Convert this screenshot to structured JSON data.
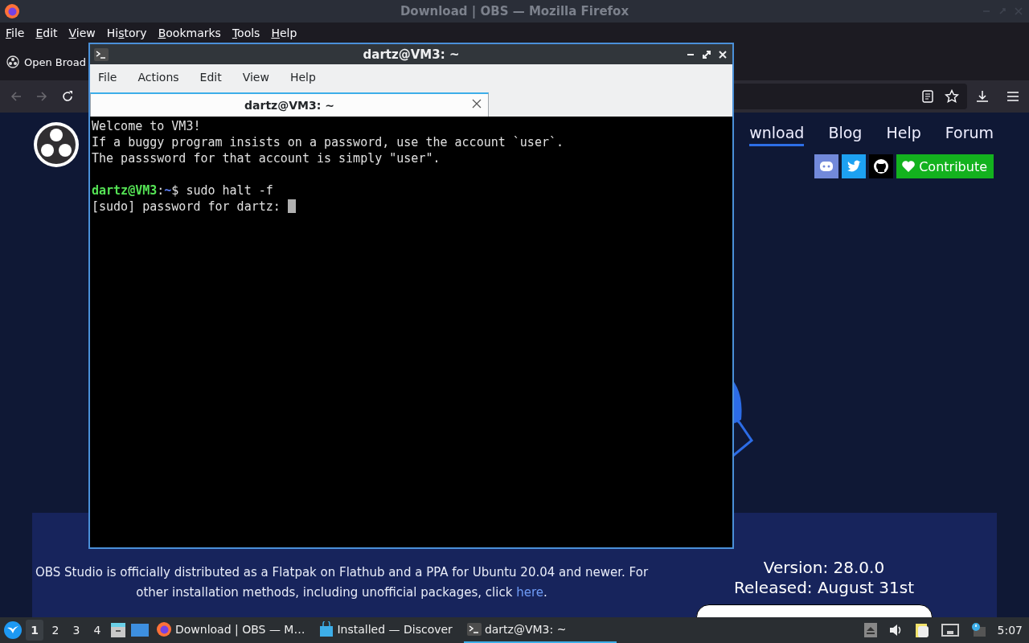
{
  "firefox": {
    "title": "Download | OBS — Mozilla Firefox",
    "menu": [
      {
        "key": "F",
        "after": "ile"
      },
      {
        "key": "E",
        "after": "dit"
      },
      {
        "key": "V",
        "after": "iew"
      },
      {
        "before": "Hi",
        "key": "s",
        "after": "tory"
      },
      {
        "key": "B",
        "after": "ookmarks"
      },
      {
        "key": "T",
        "after": "ools"
      },
      {
        "key": "H",
        "after": "elp"
      }
    ],
    "bookmark": "Open Broad",
    "page": {
      "nav": [
        {
          "label": "wnload",
          "selected": true
        },
        {
          "label": "Blog",
          "selected": false
        },
        {
          "label": "Help",
          "selected": false
        },
        {
          "label": "Forum",
          "selected": false
        }
      ],
      "contribute": "Contribute",
      "notice": "OBS Studio is officially distributed as a Flatpak on Flathub and a PPA for Ubuntu 20.04 and newer. For other installation methods, including unofficial packages, click ",
      "notice_link": "here",
      "notice_end": ".",
      "version": "Version: 28.0.0",
      "released": "Released: August 31st"
    }
  },
  "terminal": {
    "title": "dartz@VM3: ~",
    "menu": [
      "File",
      "Actions",
      "Edit",
      "View",
      "Help"
    ],
    "tab": "dartz@VM3: ~",
    "lines": [
      "Welcome to VM3!",
      "If a buggy program insists on a password, use the account `user`.",
      "The passsword for that account is simply \"user\"."
    ],
    "prompt": {
      "user_host": "dartz@VM3",
      "separator": ":",
      "path": "~",
      "symbol": "$",
      "command": " sudo halt -f"
    },
    "password_prompt": "[sudo] password for dartz: "
  },
  "taskbar": {
    "workspaces": [
      {
        "label": "1",
        "selected": true
      },
      {
        "label": "2",
        "selected": false
      },
      {
        "label": "3",
        "selected": false
      },
      {
        "label": "4",
        "selected": false
      }
    ],
    "tasks": [
      {
        "kind": "browser",
        "label": "Download | OBS — M…",
        "selected": false
      },
      {
        "kind": "store",
        "label": "Installed — Discover",
        "selected": false
      },
      {
        "kind": "terminal",
        "label": "dartz@VM3: ~",
        "selected": true
      }
    ],
    "clock": "5:07"
  }
}
